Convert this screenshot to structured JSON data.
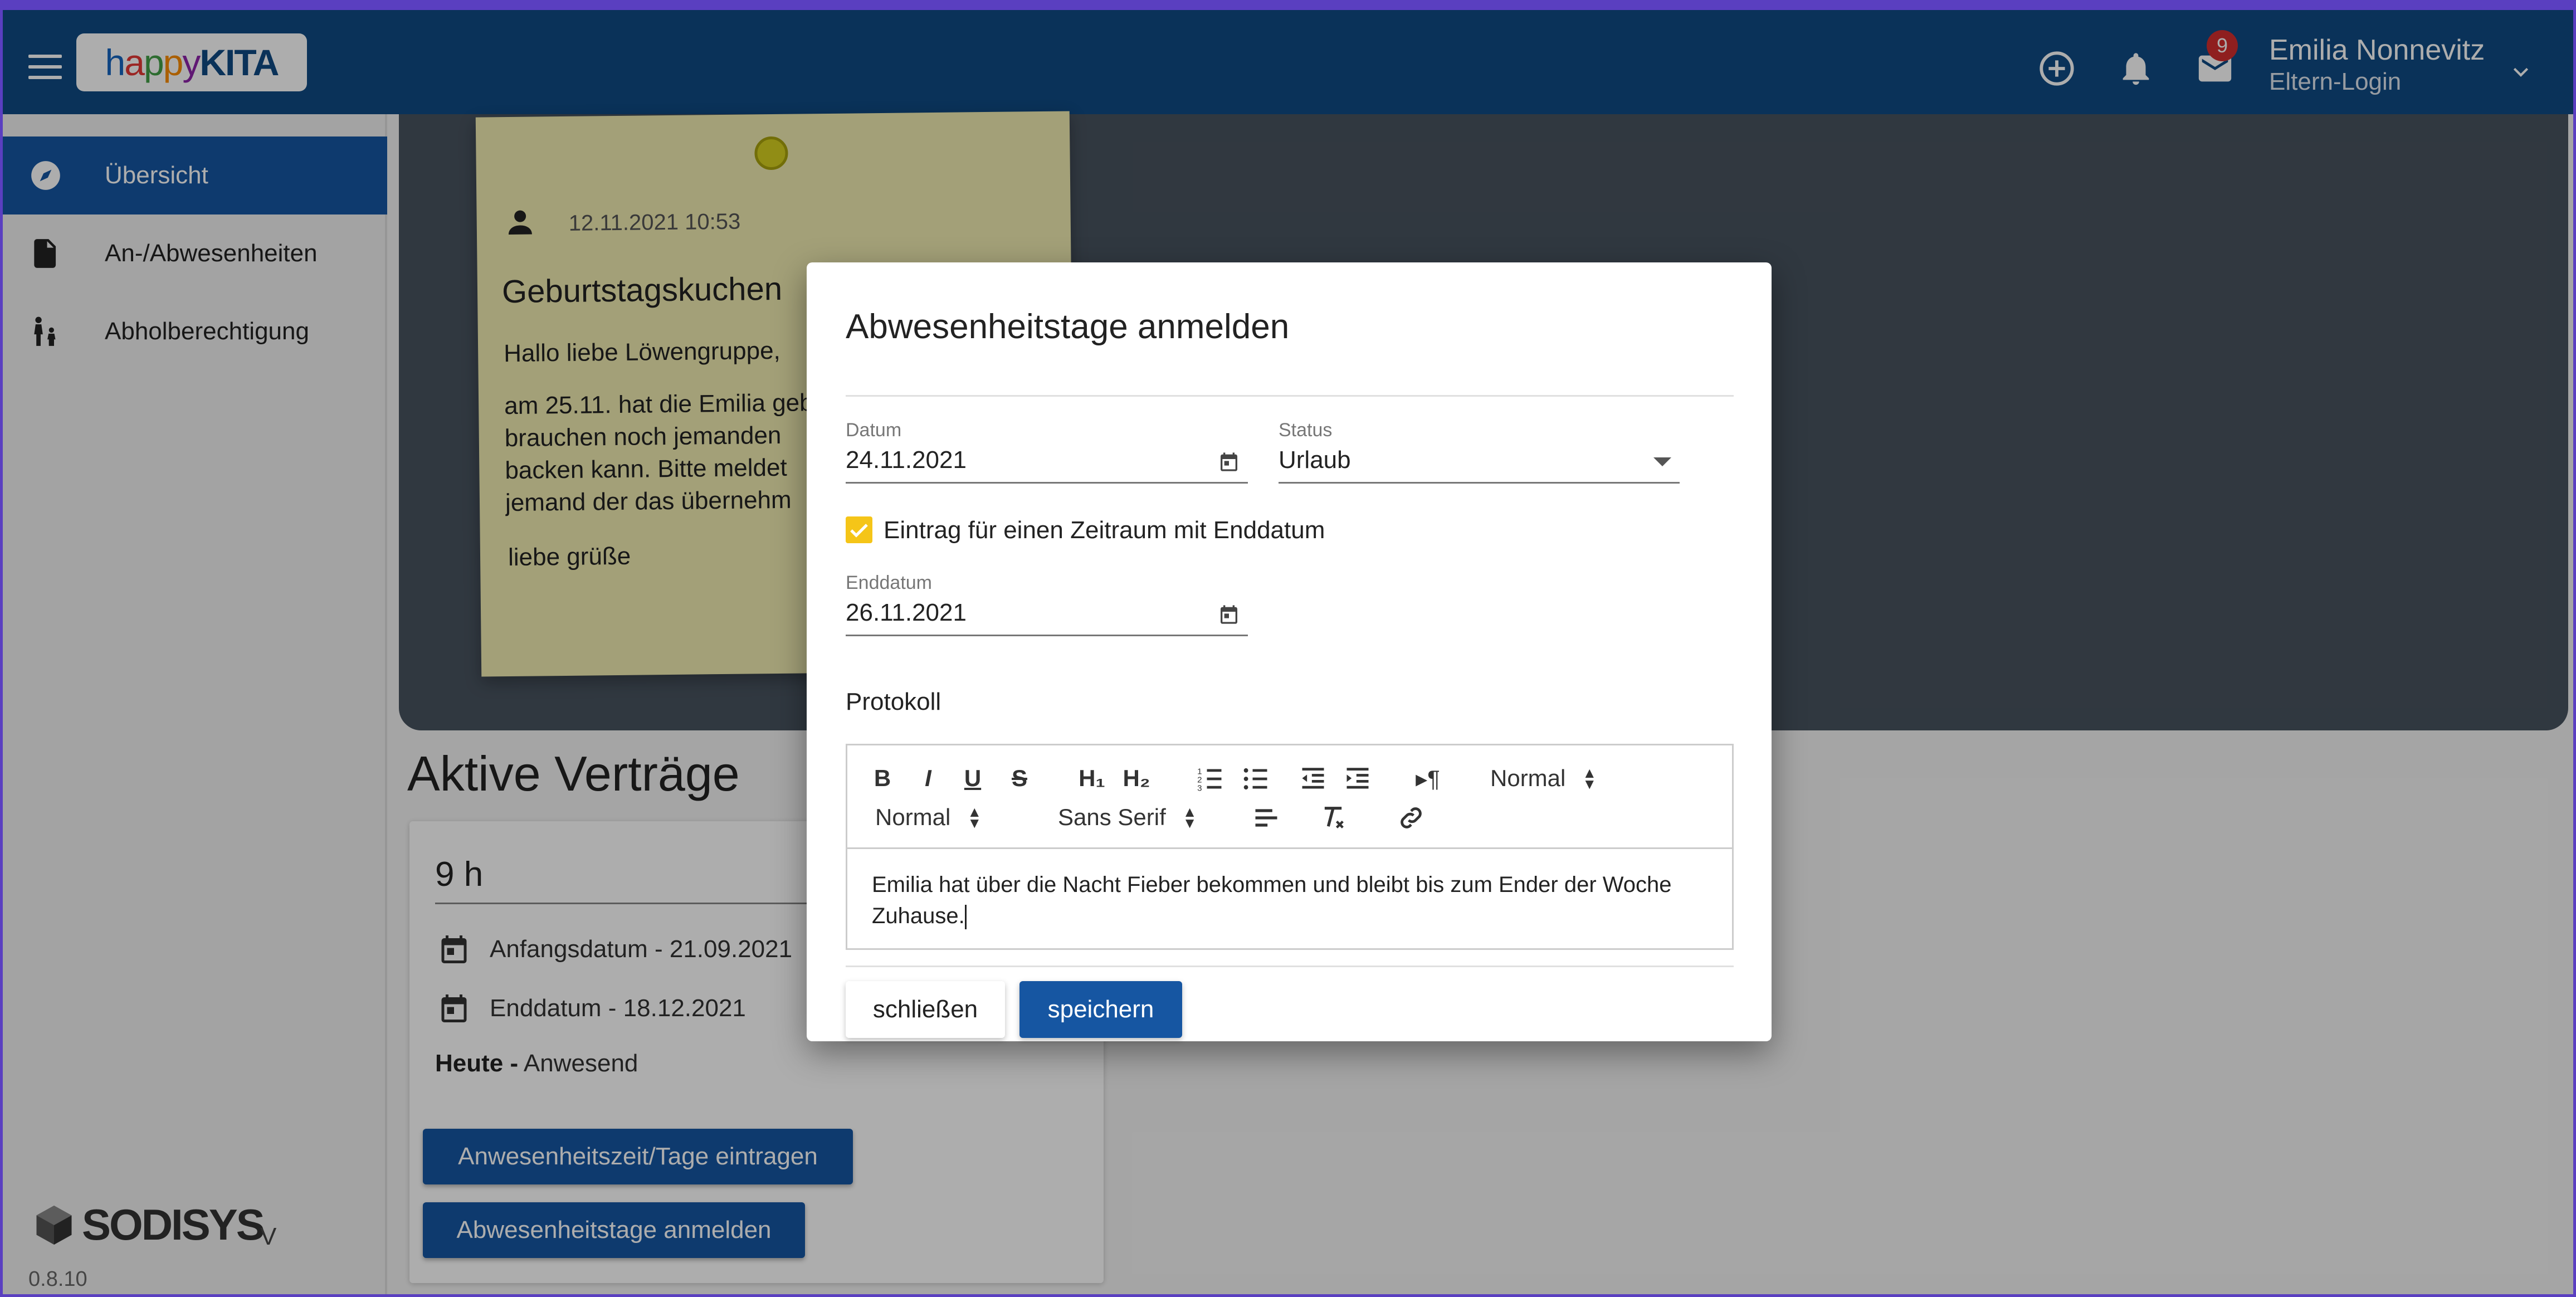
{
  "header": {
    "menu_icon": "menu-icon",
    "logo": {
      "happy": "happy",
      "kita": "KITA"
    },
    "icons": [
      "add-circle-icon",
      "bell-icon",
      "mail-icon"
    ],
    "mail_badge": "9",
    "user_name": "Emilia Nonnevitz",
    "user_role": "Eltern-Login"
  },
  "sidebar": {
    "items": [
      {
        "label": "Übersicht",
        "icon": "compass-icon",
        "active": true
      },
      {
        "label": "An-/Abwesenheiten",
        "icon": "document-icon",
        "active": false
      },
      {
        "label": "Abholberechtigung",
        "icon": "parent-child-icon",
        "active": false
      }
    ],
    "brand": "SODISYS",
    "brand_suffix": "V",
    "version": "0.8.10"
  },
  "note": {
    "date": "12.11.2021 10:53",
    "title": "Geburtstagskuchen",
    "greeting": "Hallo liebe Löwengruppe,",
    "body_lines": [
      "am 25.11. hat die Emilia geb",
      "brauchen noch jemanden",
      "backen kann. Bitte meldet",
      "jemand der das übernehm"
    ],
    "closing": "liebe grüße"
  },
  "contracts": {
    "title": "Aktive Verträge",
    "hours": "9 h",
    "start": "Anfangsdatum - 21.09.2021",
    "end": "Enddatum - 18.12.2021",
    "today_label": "Heute -",
    "today_value": "Anwesend",
    "btn_attendance": "Anwesenheitszeit/Tage eintragen",
    "btn_absence": "Abwesenheitstage anmelden"
  },
  "dialog": {
    "title": "Abwesenheitstage anmelden",
    "datum_label": "Datum",
    "datum_value": "24.11.2021",
    "status_label": "Status",
    "status_value": "Urlaub",
    "range_checkbox_label": "Eintrag für einen Zeitraum mit Enddatum",
    "range_checked": true,
    "enddatum_label": "Enddatum",
    "enddatum_value": "26.11.2021",
    "protokoll_label": "Protokoll",
    "toolbar": {
      "bold": "B",
      "italic": "I",
      "underline": "U",
      "strike": "S",
      "h1": "H₁",
      "h2": "H₂",
      "paragraph": "▸¶",
      "header_select": "Normal",
      "size_select": "Normal",
      "font_select": "Sans Serif"
    },
    "editor_text": "Emilia hat über die Nacht Fieber bekommen und bleibt bis zum Ender der Woche Zuhause.",
    "close_button": "schließen",
    "save_button": "speichern"
  },
  "colors": {
    "header": "#0f4a83",
    "primary": "#1656a2",
    "checkbox": "#f5c518",
    "badge": "#d32f2f",
    "note": "#f0ecb2"
  }
}
